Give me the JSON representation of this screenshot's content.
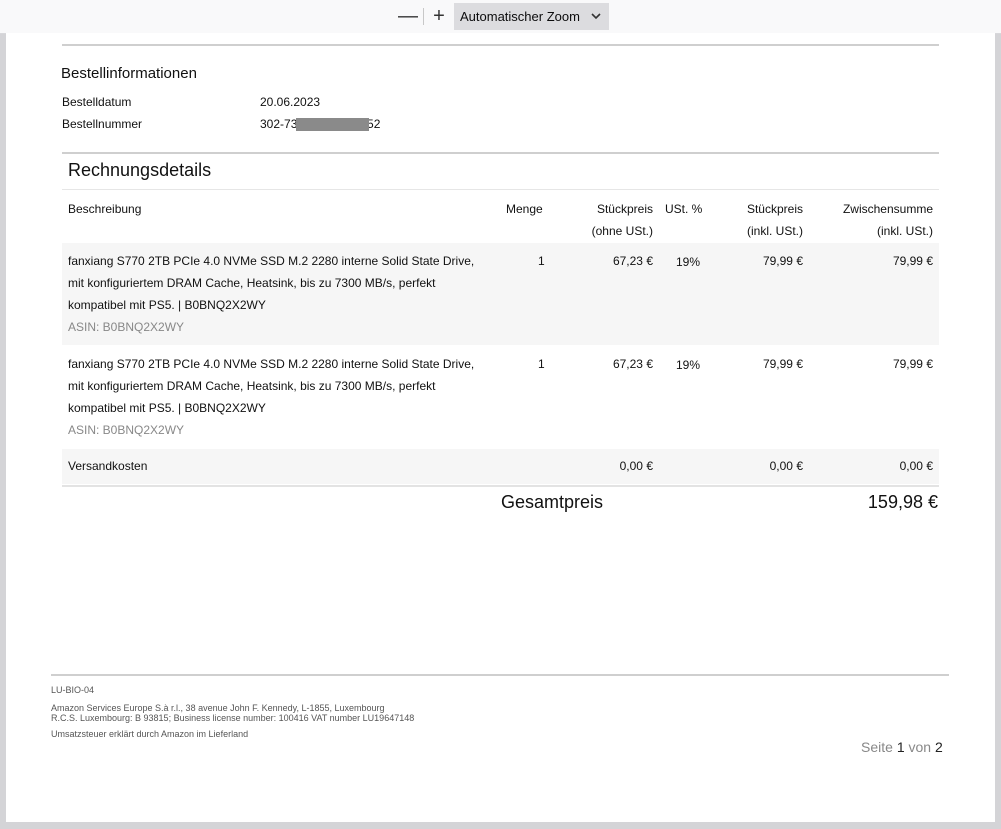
{
  "toolbar": {
    "minus_label": "—",
    "plus_label": "+",
    "zoom_label": "Automatischer Zoom",
    "chevron": "⌄"
  },
  "order_info": {
    "title": "Bestellinformationen",
    "date_label": "Bestelldatum",
    "date_value": "20.06.2023",
    "number_label": "Bestellnummer",
    "number_prefix": "302-73",
    "number_suffix": "752"
  },
  "invoice": {
    "title": "Rechnungsdetails",
    "headers": {
      "description": "Beschreibung",
      "quantity": "Menge",
      "unit_net_1": "Stückpreis",
      "unit_net_2": "(ohne USt.)",
      "vat": "USt. %",
      "unit_gross_1": "Stückpreis",
      "unit_gross_2": "(inkl. USt.)",
      "subtotal_1": "Zwischensumme",
      "subtotal_2": "(inkl. USt.)"
    },
    "items": [
      {
        "line1": "fanxiang S770 2TB PCIe 4.0 NVMe SSD M.2 2280 interne Solid State Drive,",
        "line2": "mit konfiguriertem DRAM Cache, Heatsink, bis zu 7300 MB/s, perfekt",
        "line3": "kompatibel mit PS5. | B0BNQ2X2WY",
        "asin": "ASIN: B0BNQ2X2WY",
        "quantity": "1",
        "unit_net": "67,23 €",
        "vat": "19%",
        "unit_gross": "79,99 €",
        "subtotal": "79,99 €"
      },
      {
        "line1": "fanxiang S770 2TB PCIe 4.0 NVMe SSD M.2 2280 interne Solid State Drive,",
        "line2": "mit konfiguriertem DRAM Cache, Heatsink, bis zu 7300 MB/s, perfekt",
        "line3": "kompatibel mit PS5. | B0BNQ2X2WY",
        "asin": "ASIN: B0BNQ2X2WY",
        "quantity": "1",
        "unit_net": "67,23 €",
        "vat": "19%",
        "unit_gross": "79,99 €",
        "subtotal": "79,99 €"
      }
    ],
    "shipping": {
      "label": "Versandkosten",
      "unit_net": "0,00 €",
      "unit_gross": "0,00 €",
      "subtotal": "0,00 €"
    },
    "total_label": "Gesamtpreis",
    "total_value": "159,98 €"
  },
  "footer": {
    "code": "LU-BIO-04",
    "address1": "Amazon Services Europe S.à r.l., 38 avenue John F. Kennedy, L-1855, Luxembourg",
    "address2": "R.C.S. Luxembourg: B 93815; Business license number: 100416 VAT number LU19647148",
    "vat_note": "Umsatzsteuer erklärt durch Amazon im Lieferland",
    "page_word": "Seite",
    "page_current": "1",
    "page_of": "von",
    "page_total": "2"
  }
}
